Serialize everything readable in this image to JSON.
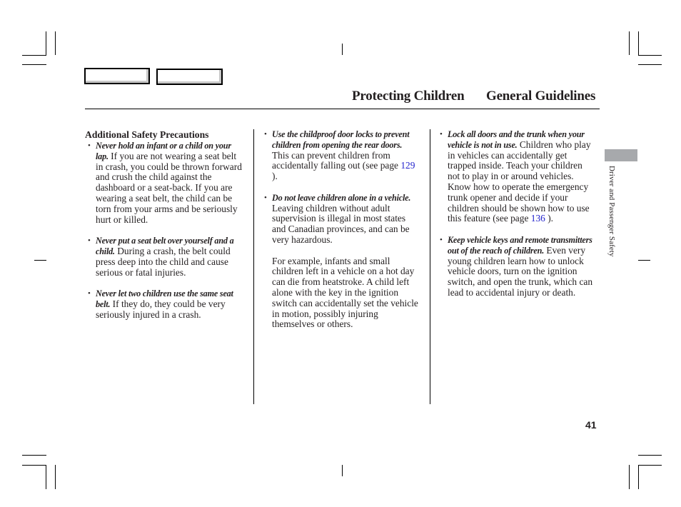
{
  "header": {
    "section_title": "Protecting Children",
    "subsection_title": "General Guidelines"
  },
  "nav_buttons": [
    {
      "label": ""
    },
    {
      "label": ""
    }
  ],
  "side_tab": {
    "label": "Driver and Passenger Safety",
    "color": "#a7a9ac"
  },
  "page_number": "41",
  "columns": [
    {
      "heading": "Additional Safety Precautions",
      "items": [
        {
          "lead": "Never hold an infant or a child on your lap.",
          "body": " If you are not wearing a seat belt in crash, you could be thrown forward and crush the child against the dashboard or a seat-back. If you are wearing a seat belt, the child can be torn from your arms and be seriously hurt or killed."
        },
        {
          "lead": "Never put a seat belt over yourself and a child.",
          "body": " During a crash, the belt could press deep into the child and cause serious or fatal injuries."
        },
        {
          "lead": "Never let two children use the same seat belt.",
          "body": " If they do, they could be very seriously injured in a crash."
        }
      ]
    },
    {
      "items": [
        {
          "lead": "Use the childproof door locks to prevent children from opening the rear doors.",
          "body": " This can prevent children from accidentally falling out (see page ",
          "link": "129",
          "tail": " )."
        },
        {
          "lead": "Do not leave children alone in a vehicle.",
          "body": " Leaving children without adult supervision is illegal in most states and Canadian provinces, and can be very hazardous."
        }
      ],
      "paragraph": "For example, infants and small children left in a vehicle on a hot day can die from heatstroke. A child left alone with the key in the ignition switch can accidentally set the vehicle in motion, possibly injuring themselves or others."
    },
    {
      "items": [
        {
          "lead": "Lock all doors and the trunk when your vehicle is not in use.",
          "body": " Children who play in vehicles can accidentally get trapped inside. Teach your children not to play in or around vehicles. Know how to operate the emergency trunk opener and decide if your children should be shown how to use this feature (see page ",
          "link": "136",
          "tail": " )."
        },
        {
          "lead": "Keep vehicle keys and remote transmitters out of the reach of children.",
          "body": " Even very young children learn how to unlock vehicle doors, turn on the ignition switch, and open the trunk, which can lead to accidental injury or death."
        }
      ]
    }
  ],
  "bullet_glyph": "•",
  "colors": {
    "link": "#2222cc",
    "text": "#231f20"
  }
}
